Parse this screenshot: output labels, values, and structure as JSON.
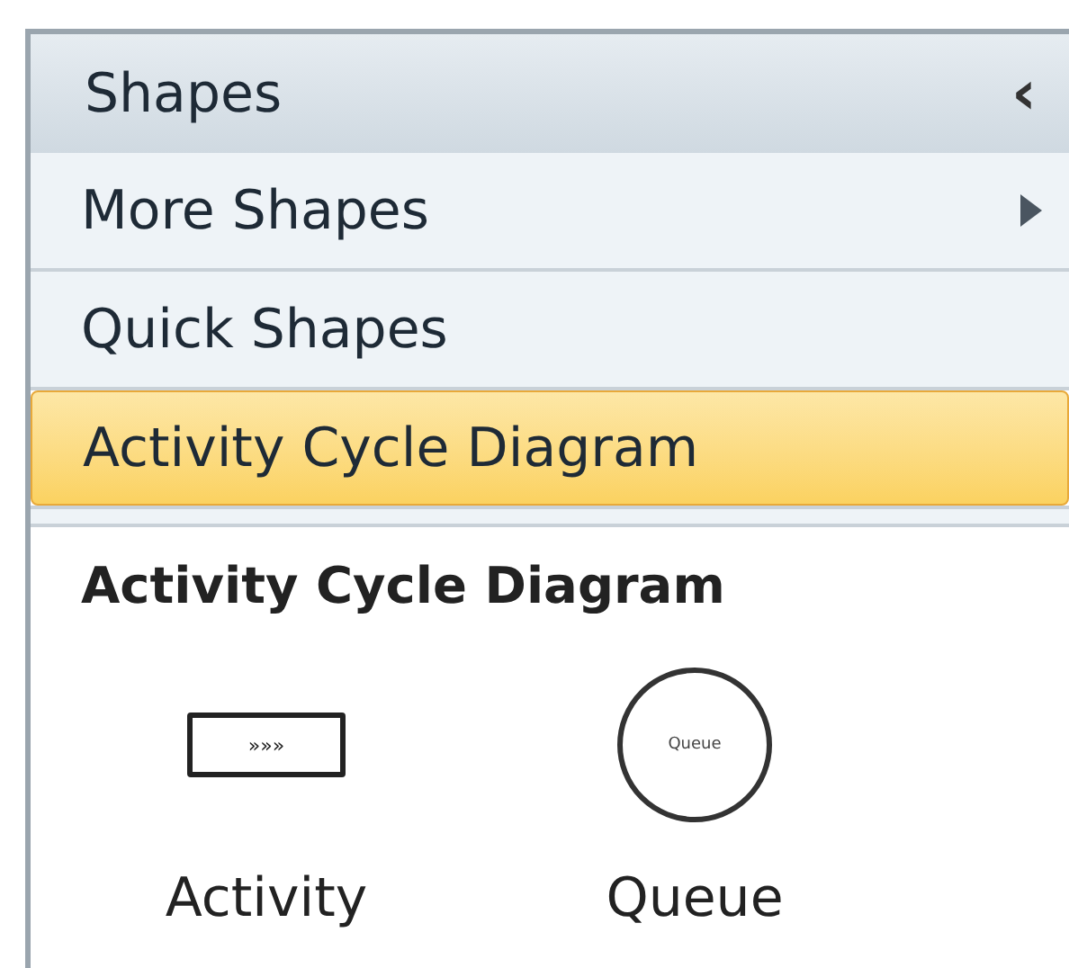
{
  "header": {
    "title": "Shapes",
    "collapse_icon": "‹"
  },
  "menu": [
    {
      "label": "More Shapes",
      "kind": "submenu",
      "selected": false
    },
    {
      "label": "Quick Shapes",
      "kind": "item",
      "selected": false
    },
    {
      "label": "Activity Cycle Diagram",
      "kind": "item",
      "selected": true
    }
  ],
  "stencil": {
    "title": "Activity Cycle Diagram",
    "shapes": [
      {
        "label": "Activity",
        "kind": "rectangle",
        "inner_text": "»»»"
      },
      {
        "label": "Queue",
        "kind": "circle",
        "inner_text": "Queue"
      }
    ]
  }
}
